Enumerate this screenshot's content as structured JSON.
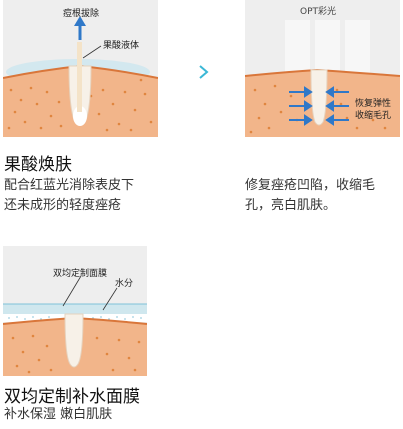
{
  "panel1": {
    "label_top": "痘根拔除",
    "label_side": "果酸液体",
    "title": "果酸焕肤",
    "desc_line1": "配合红蓝光消除表皮下",
    "desc_line2": "还未成形的轻度痤疮"
  },
  "panel2": {
    "label_top": "OPT彩光",
    "label_side_1": "恢复弹性",
    "label_side_2": "收缩毛孔",
    "desc_line1": "修复痤疮凹陷，收缩毛",
    "desc_line2": "孔，亮白肌肤。"
  },
  "panel3": {
    "label_mask": "双均定制面膜",
    "label_water": "水分",
    "title": "双均定制补水面膜",
    "desc_line1": "补水保湿 嫩白肌肤"
  },
  "colors": {
    "panel_bg": "#eeeeee",
    "skin": "#f2b58a",
    "skin_dot": "#e0853f",
    "arrow_blue": "#2f78c8",
    "accent_cyan": "#3bb8d6"
  }
}
